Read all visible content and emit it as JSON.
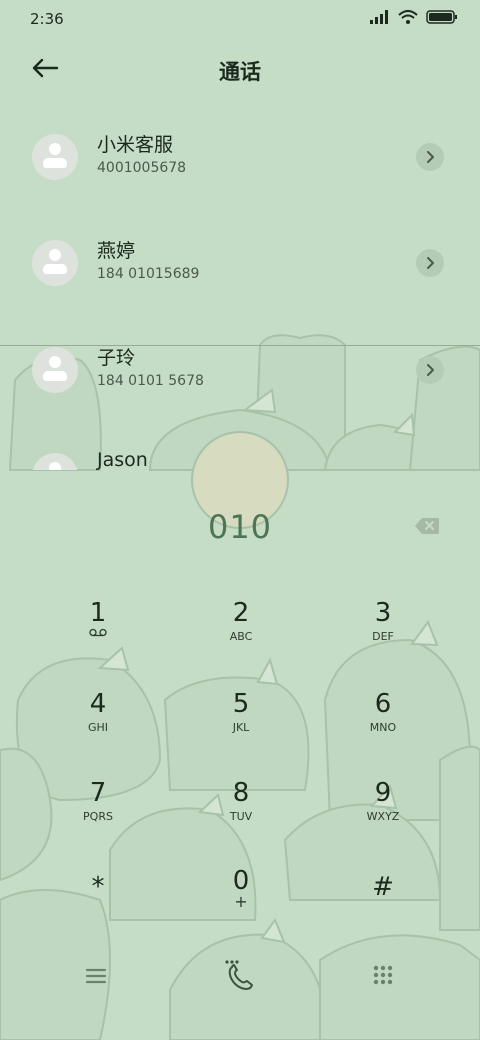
{
  "status": {
    "time": "2:36"
  },
  "header": {
    "title": "通话"
  },
  "contacts": [
    {
      "name": "小米客服",
      "number": "4001005678"
    },
    {
      "name": "燕婷",
      "number": "184 01015689"
    },
    {
      "name": "子玲",
      "number": "184 0101 5678"
    },
    {
      "name": "Jason",
      "number": ""
    }
  ],
  "dialer": {
    "value": "010",
    "keys": [
      {
        "digit": "1",
        "letters": ""
      },
      {
        "digit": "2",
        "letters": "ABC"
      },
      {
        "digit": "3",
        "letters": "DEF"
      },
      {
        "digit": "4",
        "letters": "GHI"
      },
      {
        "digit": "5",
        "letters": "JKL"
      },
      {
        "digit": "6",
        "letters": "MNO"
      },
      {
        "digit": "7",
        "letters": "PQRS"
      },
      {
        "digit": "8",
        "letters": "TUV"
      },
      {
        "digit": "9",
        "letters": "WXYZ"
      },
      {
        "digit": "*",
        "letters": ""
      },
      {
        "digit": "0",
        "letters": "+"
      },
      {
        "digit": "#",
        "letters": ""
      }
    ]
  },
  "icons": {
    "back": "arrow-left-icon",
    "backspace": "backspace-icon",
    "voicemail": "voicemail-icon",
    "menu": "menu-icon",
    "call": "phone-call-icon",
    "keypad": "dialpad-icon"
  },
  "colors": {
    "background": "#c5dcc6",
    "accent": "#4e7355"
  }
}
